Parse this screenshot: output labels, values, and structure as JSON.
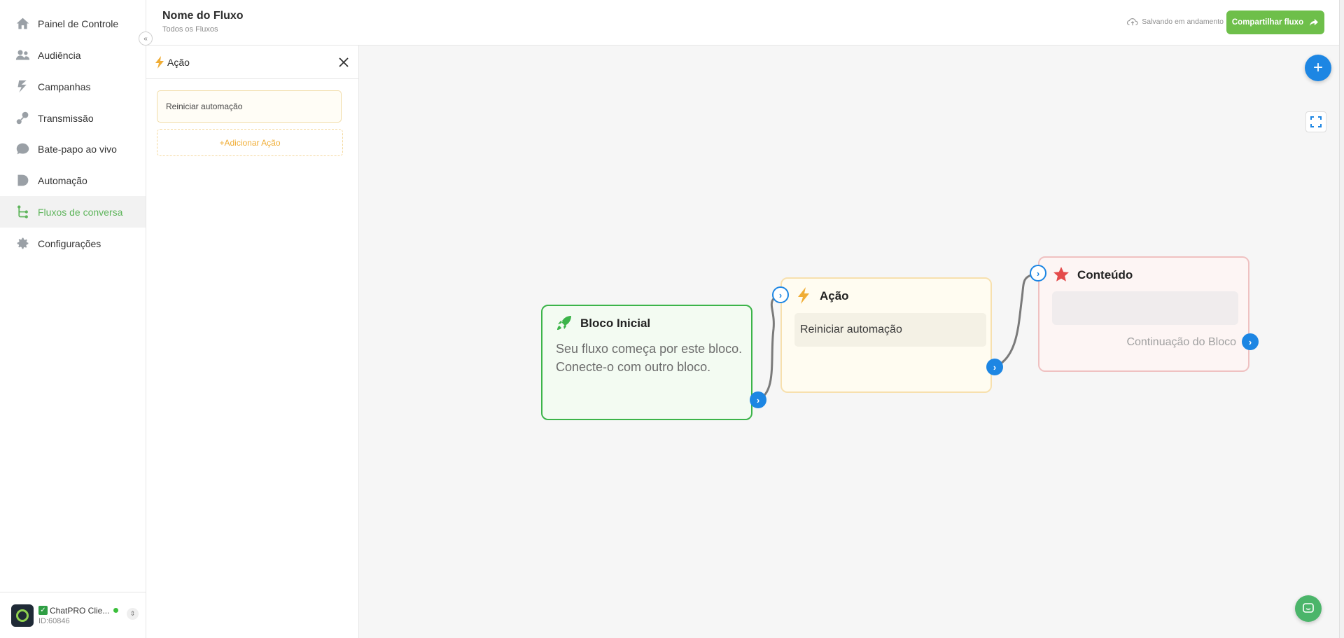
{
  "sidebar": {
    "items": [
      {
        "label": "Painel de Controle",
        "icon": "home-icon"
      },
      {
        "label": "Audiência",
        "icon": "users-icon"
      },
      {
        "label": "Campanhas",
        "icon": "campaign-icon"
      },
      {
        "label": "Transmissão",
        "icon": "broadcast-icon"
      },
      {
        "label": "Bate-papo ao vivo",
        "icon": "chat-icon"
      },
      {
        "label": "Automação",
        "icon": "automation-icon"
      },
      {
        "label": "Fluxos de conversa",
        "icon": "flow-icon",
        "active": true
      },
      {
        "label": "Configurações",
        "icon": "gear-icon"
      }
    ],
    "user": {
      "name": "ChatPRO Clie...",
      "id": "ID:60846"
    }
  },
  "header": {
    "title": "Nome do Fluxo",
    "breadcrumb": "Todos os Fluxos",
    "saving_status": "Salvando em andamento",
    "share_label": "Compartilhar fluxo"
  },
  "panel": {
    "title": "Ação",
    "action_item": "Reiniciar automação",
    "add_action_label": "+Adicionar Ação"
  },
  "canvas": {
    "start_node": {
      "title": "Bloco Inicial",
      "description": "Seu fluxo começa por este bloco. Conecte-o com outro bloco."
    },
    "action_node": {
      "title": "Ação",
      "item": "Reiniciar automação"
    },
    "content_node": {
      "title": "Conteúdo",
      "continue_label": "Continuação do Bloco"
    }
  },
  "colors": {
    "brand_green": "#6ebf4a",
    "active_nav": "#5fb55c",
    "port_blue": "#1d86e3",
    "action_amber": "#f0ad35",
    "content_red": "#e44b4b"
  }
}
